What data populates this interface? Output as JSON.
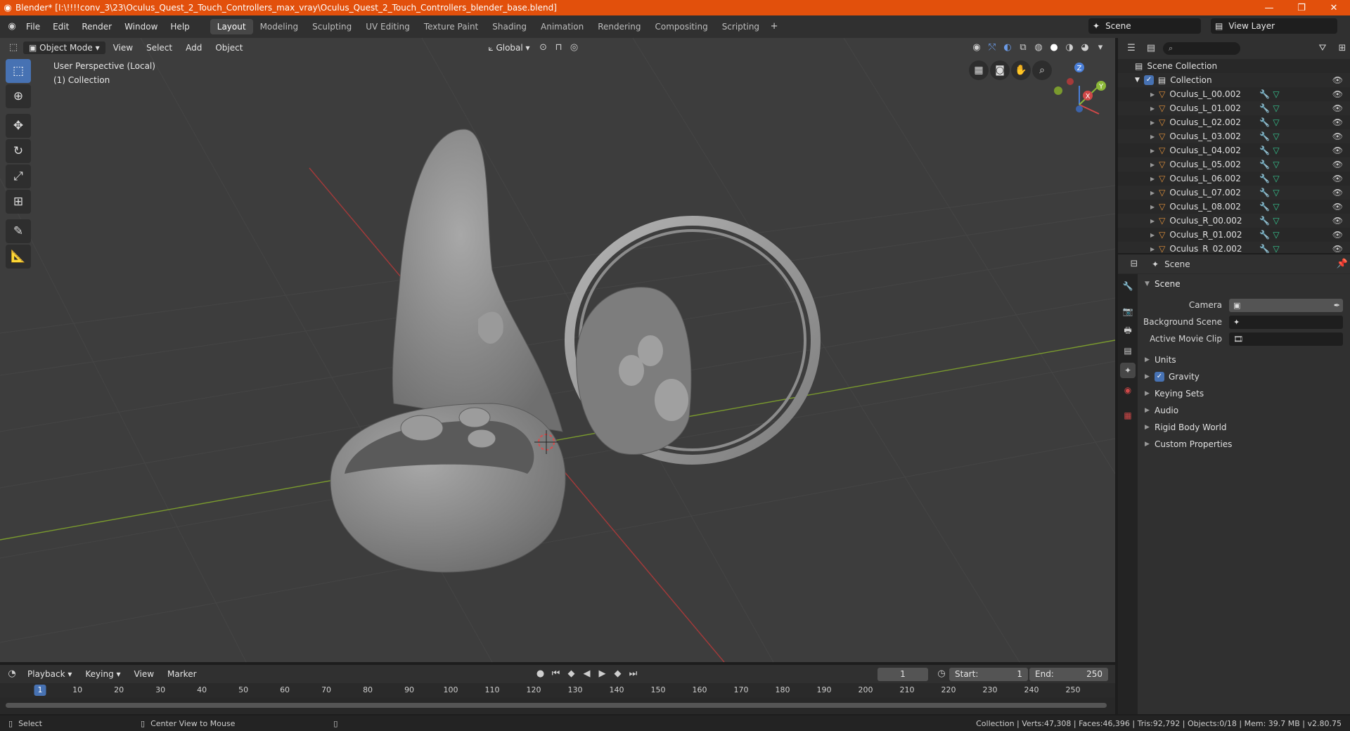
{
  "window": {
    "title": "Blender* [I:\\!!!!conv_3\\23\\Oculus_Quest_2_Touch_Controllers_max_vray\\Oculus_Quest_2_Touch_Controllers_blender_base.blend]"
  },
  "menu": [
    "File",
    "Edit",
    "Render",
    "Window",
    "Help"
  ],
  "workspaces": [
    "Layout",
    "Modeling",
    "Sculpting",
    "UV Editing",
    "Texture Paint",
    "Shading",
    "Animation",
    "Rendering",
    "Compositing",
    "Scripting"
  ],
  "scene_name": "Scene",
  "view_layer": "View Layer",
  "viewport": {
    "mode": "Object Mode",
    "menus": [
      "View",
      "Select",
      "Add",
      "Object"
    ],
    "orientation": "Global",
    "info_line1": "User Perspective (Local)",
    "info_line2": "(1) Collection",
    "gizmo": {
      "x": "X",
      "y": "Y",
      "z": "Z"
    }
  },
  "outliner": {
    "root": "Scene Collection",
    "collection": "Collection",
    "items": [
      "Oculus_L_00.002",
      "Oculus_L_01.002",
      "Oculus_L_02.002",
      "Oculus_L_03.002",
      "Oculus_L_04.002",
      "Oculus_L_05.002",
      "Oculus_L_06.002",
      "Oculus_L_07.002",
      "Oculus_L_08.002",
      "Oculus_R_00.002",
      "Oculus_R_01.002",
      "Oculus_R_02.002"
    ]
  },
  "properties": {
    "context": "Scene",
    "panel": "Scene",
    "camera_label": "Camera",
    "bg_scene_label": "Background Scene",
    "movie_clip_label": "Active Movie Clip",
    "subpanels": [
      "Units",
      "Gravity",
      "Keying Sets",
      "Audio",
      "Rigid Body World",
      "Custom Properties"
    ]
  },
  "timeline": {
    "menus": [
      "Playback",
      "Keying",
      "View",
      "Marker"
    ],
    "current_frame": "1",
    "start_label": "Start:",
    "start": "1",
    "end_label": "End:",
    "end": "250",
    "ticks": [
      "1",
      "10",
      "20",
      "30",
      "40",
      "50",
      "60",
      "70",
      "80",
      "90",
      "100",
      "110",
      "120",
      "130",
      "140",
      "150",
      "160",
      "170",
      "180",
      "190",
      "200",
      "210",
      "220",
      "230",
      "240",
      "250"
    ]
  },
  "status": {
    "left": "Select",
    "middle": "Center View to Mouse",
    "right": "Collection | Verts:47,308 | Faces:46,396 | Tris:92,792 | Objects:0/18 | Mem: 39.7 MB | v2.80.75"
  },
  "colors": {
    "accent": "#4772b3",
    "titlebar": "#e2500c",
    "x_axis": "#d04848",
    "y_axis": "#8cb838",
    "z_axis": "#4a7fd8"
  }
}
